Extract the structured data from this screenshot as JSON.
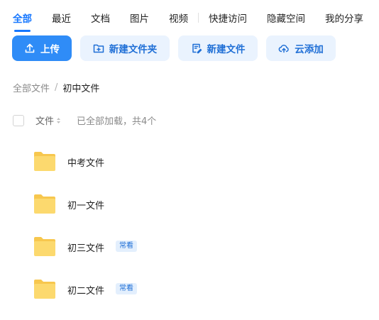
{
  "tabs": [
    {
      "label": "全部",
      "active": true
    },
    {
      "label": "最近"
    },
    {
      "label": "文档"
    },
    {
      "label": "图片"
    },
    {
      "label": "视频"
    },
    {
      "label": "快捷访问"
    },
    {
      "label": "隐藏空间"
    },
    {
      "label": "我的分享"
    }
  ],
  "toolbar": {
    "upload_label": "上传",
    "new_folder_label": "新建文件夹",
    "new_file_label": "新建文件",
    "cloud_add_label": "云添加"
  },
  "breadcrumb": {
    "root": "全部文件",
    "separator": "/",
    "current": "初中文件"
  },
  "list_header": {
    "name_column": "文件",
    "status": "已全部加载，共4个"
  },
  "files": [
    {
      "name": "中考文件",
      "badge": "",
      "icon": "folder-icon"
    },
    {
      "name": "初一文件",
      "badge": "",
      "icon": "folder-icon"
    },
    {
      "name": "初三文件",
      "badge": "常看",
      "icon": "folder-icon"
    },
    {
      "name": "初二文件",
      "badge": "常看",
      "icon": "folder-icon"
    }
  ],
  "colors": {
    "accent": "#1677ff",
    "primary_button": "#2f8cf7",
    "light_button": "#eaf3fe",
    "folder": "#fcd667"
  }
}
